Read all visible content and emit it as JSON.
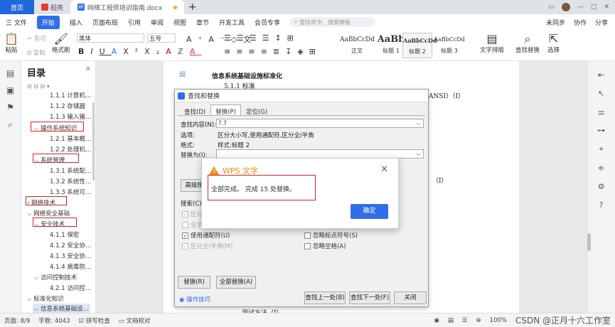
{
  "tabbar": {
    "home": "首页",
    "app": "稻壳",
    "doc": "网络工程师培训指南.docx"
  },
  "menu": {
    "file": "三 文件",
    "items": [
      "开始",
      "插入",
      "页面布局",
      "引用",
      "审阅",
      "视图",
      "章节",
      "开发工具",
      "会员专享"
    ],
    "search": "查找命令、搜索模板",
    "unsync": "未同步",
    "collab": "协作",
    "share": "分享"
  },
  "ribbon": {
    "paste": "粘贴",
    "cut": "剪切",
    "copy": "复制",
    "format_painter": "格式刷",
    "font": "黑体",
    "size": "五号",
    "styles": [
      {
        "prev": "AaBbCcDd",
        "name": "正文"
      },
      {
        "prev": "AaBb",
        "name": "标题 1"
      },
      {
        "prev": "AaBbCcDd",
        "name": "标题 2"
      },
      {
        "prev": "AaBbCcDd",
        "name": "标题 3"
      }
    ],
    "text_layout": "文字排版",
    "find_replace": "查找替换",
    "select": "选择"
  },
  "toc": {
    "title": "目录",
    "items": [
      "1.1.1 计算机…",
      "1.1.2 存储器",
      "1.1.3 输入输…",
      "操作系统知识",
      "1.2.1 基本概…",
      "1.2.2 处理机…",
      "系统管理",
      "1.3.1 系统配…",
      "1.3.2 系统性…",
      "1.3.3 系统可…",
      "网络技术",
      "网络安全基础",
      "安全技术",
      "4.1.1 保密",
      "4.1.2 安全协…",
      "4.1.3 安全协…",
      "4.1.4 病毒防…",
      "访问控制技术",
      "4.2.1 访问控…",
      "标准化知识",
      "信息系统基础设…"
    ]
  },
  "doc": {
    "heading": "信息系统基础设施标准化",
    "sub": "5.1.1 标准",
    "ansi": "ANSI）（I）",
    "i2": "（I）",
    "bottom": "测试方法（I）"
  },
  "dialog": {
    "title": "查找和替换",
    "tabs": [
      "查找(D)",
      "替换(P)",
      "定位(G)"
    ],
    "find_label": "查找内容(N):",
    "find_value": "?.?",
    "options_label": "选项:",
    "options_value": "区分大小写,使用通配符,区分全/半角",
    "format_label": "格式:",
    "format_value": "样式:标题 2",
    "replace_label": "替换为(I):",
    "advanced": "高级搜",
    "search_label": "搜索(C)",
    "case": "区分",
    "whole": "全字",
    "wildcard": "使用通配符(U)",
    "width": "区分全/半角(M)",
    "ignore_punct": "忽略标点符号(S)",
    "ignore_space": "忽略空格(A)",
    "replace_btn": "替换(R)",
    "replace_all_btn": "全部替换(A)",
    "tips": "操作技巧",
    "find_prev": "查找上一处(B)",
    "find_next": "查找下一处(F)",
    "close": "关闭"
  },
  "alert": {
    "title": "WPS 文字",
    "message": "全部完成。 完成 15 处替换。",
    "ok": "确定"
  },
  "status": {
    "page": "页面: 8/9",
    "words": "字数: 4043",
    "spell": "拼写检查",
    "proof": "文档校对",
    "zoom": "100%",
    "watermark": "CSDN @正月十六工作室"
  }
}
